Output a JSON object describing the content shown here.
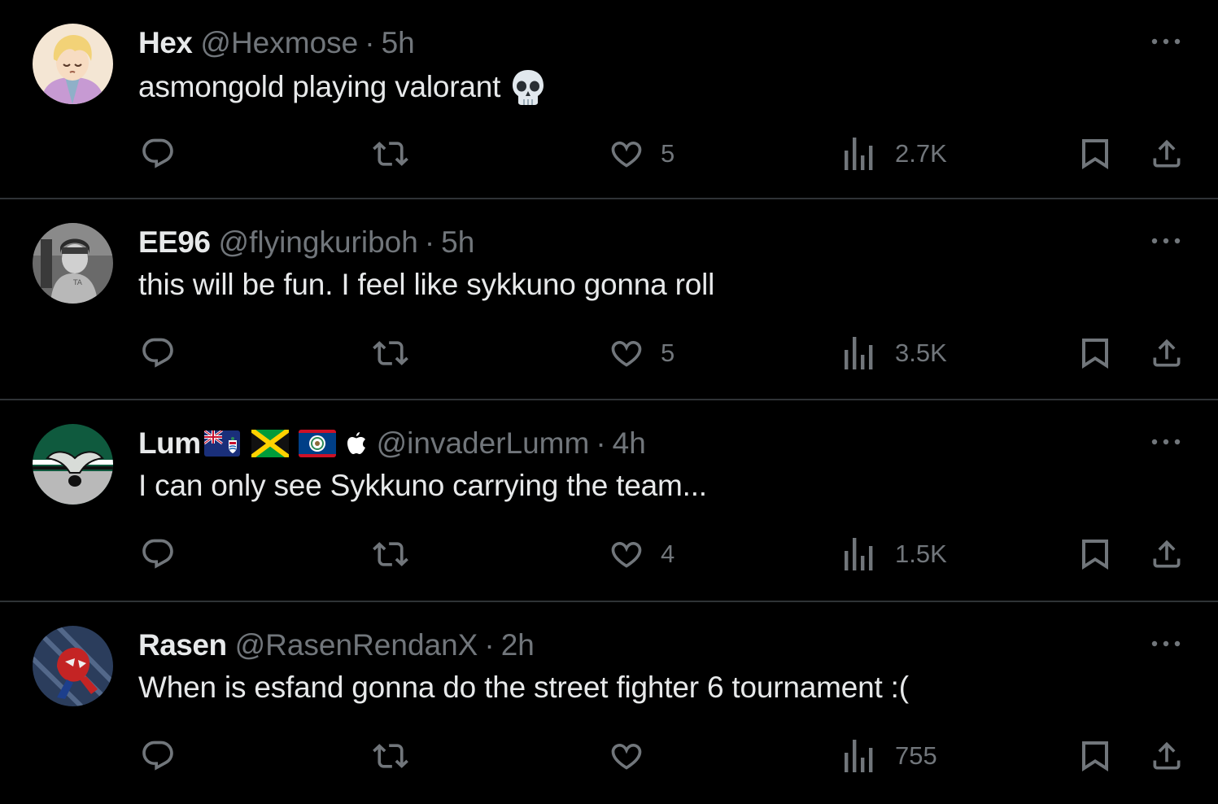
{
  "tweets": [
    {
      "name": "Hex",
      "handle": "@Hexmose",
      "separator": "·",
      "time": "5h",
      "text": "asmongold playing valorant",
      "emoji": "skull-emoji",
      "likes": "5",
      "views": "2.7K"
    },
    {
      "name": "EE96",
      "handle": "@flyingkuriboh",
      "separator": "·",
      "time": "5h",
      "text": "this will be fun. I feel like sykkuno gonna roll",
      "likes": "5",
      "views": "3.5K"
    },
    {
      "name": "Lum",
      "name_flags": [
        "cayman-islands-flag",
        "jamaica-flag",
        "belize-flag",
        "apple-icon"
      ],
      "handle": "@invaderLumm",
      "separator": "·",
      "time": "4h",
      "text": "I can only see Sykkuno carrying the team...",
      "likes": "4",
      "views": "1.5K"
    },
    {
      "name": "Rasen",
      "handle": "@RasenRendanX",
      "separator": "·",
      "time": "2h",
      "text": "When is esfand gonna do the street fighter 6 tournament :(",
      "likes": "",
      "views": "755"
    }
  ],
  "colors": {
    "background": "#000000",
    "text_primary": "#e7e9ea",
    "text_secondary": "#71767b",
    "divider": "#2f3336"
  },
  "icons": {
    "reply": "reply-icon",
    "retweet": "retweet-icon",
    "like": "heart-icon",
    "views": "views-icon",
    "bookmark": "bookmark-icon",
    "share": "share-icon",
    "more": "more-icon"
  }
}
